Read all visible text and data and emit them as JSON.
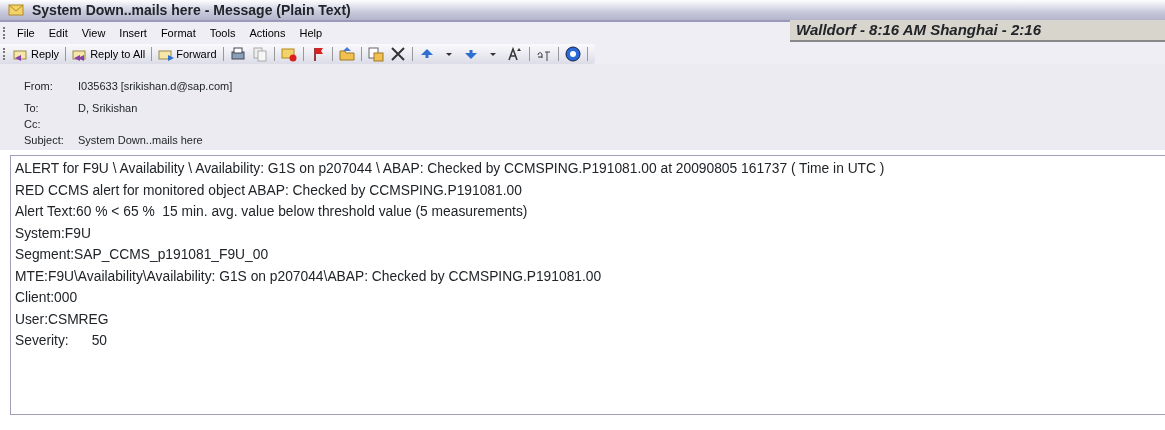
{
  "window": {
    "title": "System Down..mails here - Message (Plain Text)"
  },
  "menu": [
    "File",
    "Edit",
    "View",
    "Insert",
    "Format",
    "Tools",
    "Actions",
    "Help"
  ],
  "clock": "Walldorf - 8:16 AM  Shanghai - 2:16",
  "toolbar": [
    {
      "label": "Reply"
    },
    {
      "label": "Reply to All"
    },
    {
      "label": "Forward"
    }
  ],
  "header": [
    {
      "label": "From:",
      "value": "I035633 [srikishan.d@sap.com]"
    },
    {
      "label": "To:",
      "value": "D, Srikishan"
    },
    {
      "label": "Cc:"
    },
    {
      "label": "Subject:",
      "value": "System Down..mails here"
    }
  ],
  "body": [
    "ALERT for F9U \\ Availability \\ Availability: G1S on p207044 \\ ABAP: Checked by CCMSPING.P191081.00 at 20090805 161737 ( Time in UTC )",
    "RED CCMS alert for monitored object ABAP: Checked by CCMSPING.P191081.00",
    "Alert Text:60 % < 65 %  15 min. avg. value below threshold value (5 measurements)",
    "System:F9U",
    "Segment:SAP_CCMS_p191081_F9U_00",
    "MTE:F9U\\Availability\\Availability: G1S on p207044\\ABAP: Checked by CCMSPING.P191081.00",
    "Client:000",
    "User:CSMREG",
    "Severity:      50"
  ]
}
